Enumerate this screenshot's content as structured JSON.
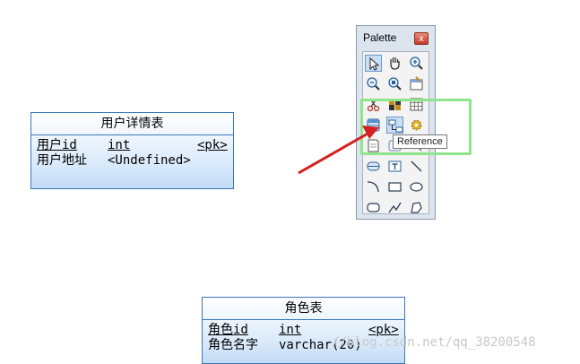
{
  "entities": {
    "user_detail": {
      "title": "用户详情表",
      "attributes": [
        {
          "name": "用户id",
          "type": "int",
          "key": "<pk>"
        },
        {
          "name": "用户地址",
          "type": "<Undefined>",
          "key": ""
        }
      ]
    },
    "role": {
      "title": "角色表",
      "attributes": [
        {
          "name": "角色id",
          "type": "int",
          "key": "<pk>"
        },
        {
          "name": "角色名字",
          "type": "varchar(20)",
          "key": ""
        }
      ]
    }
  },
  "palette": {
    "title": "Palette",
    "close_glyph": "x",
    "tools": [
      {
        "icon": "pointer-icon"
      },
      {
        "icon": "hand-icon"
      },
      {
        "icon": "zoom-in-icon"
      },
      {
        "icon": "zoom-out-icon"
      },
      {
        "icon": "zoom-fit-icon"
      },
      {
        "icon": "properties-icon"
      },
      {
        "icon": "cut-icon"
      },
      {
        "icon": "package-icon"
      },
      {
        "icon": "grid-icon"
      },
      {
        "icon": "table-icon"
      },
      {
        "icon": "reference-icon"
      },
      {
        "icon": "gear-icon"
      },
      {
        "icon": "note-icon"
      },
      {
        "icon": "view-icon"
      },
      {
        "icon": "link-icon"
      },
      {
        "icon": "rounded-entity-icon"
      },
      {
        "icon": "text-icon"
      },
      {
        "icon": "line-icon"
      },
      {
        "icon": "arc-icon"
      },
      {
        "icon": "rectangle-icon"
      },
      {
        "icon": "ellipse-icon"
      },
      {
        "icon": "rounded-rect-icon"
      },
      {
        "icon": "polyline-icon"
      },
      {
        "icon": "polygon-icon"
      }
    ]
  },
  "tooltip": {
    "text": "Reference"
  },
  "annotation": {
    "highlight_color": "#8fe58a",
    "arrow_color": "#d42020"
  },
  "watermark": {
    "text": "//blog.csdn.net/qq_38200548"
  }
}
